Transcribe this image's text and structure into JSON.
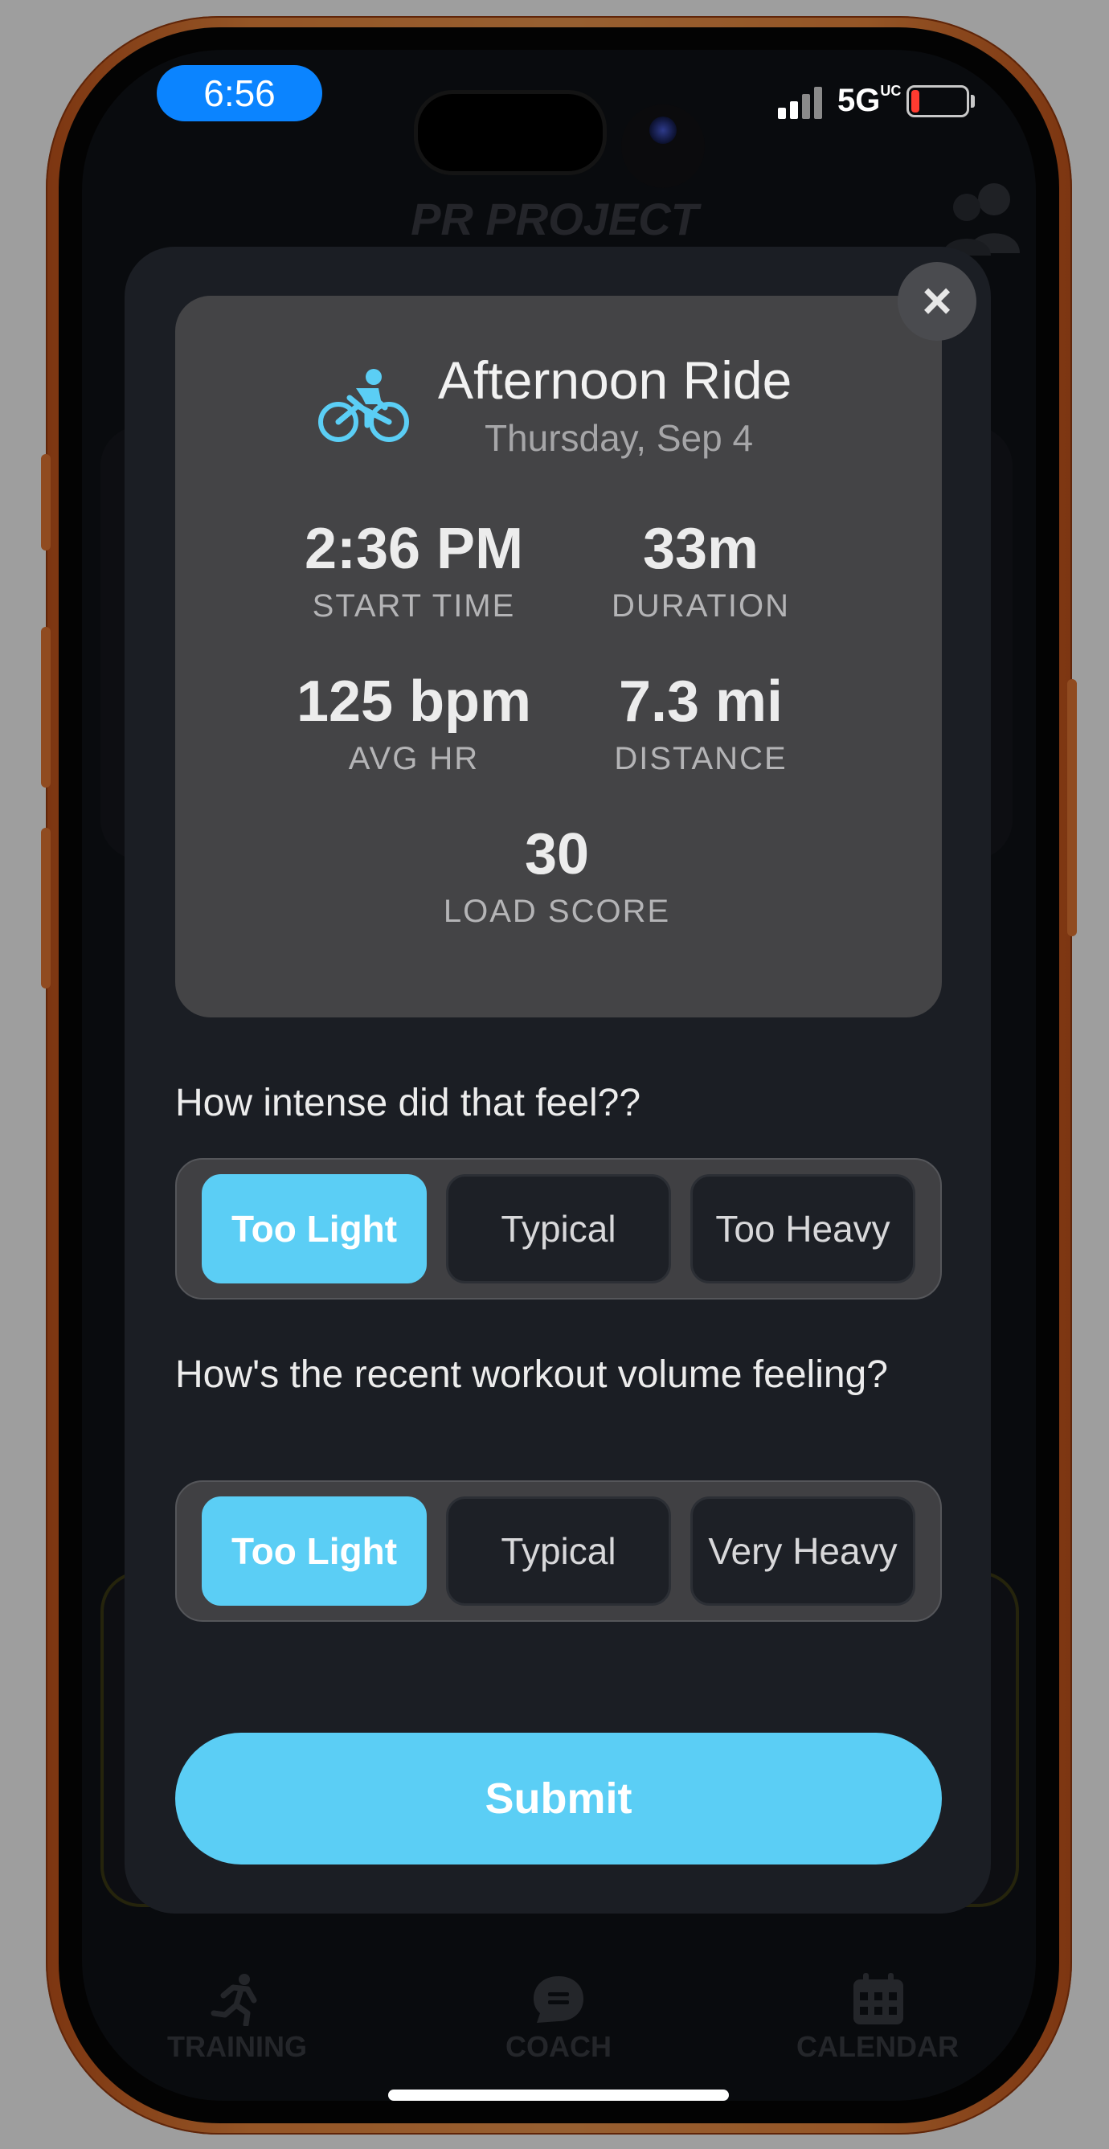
{
  "status_bar": {
    "time": "6:56",
    "network": "5G"
  },
  "background": {
    "app_title": "PR PROJECT",
    "tabs": [
      {
        "label": "TRAINING",
        "icon": "runner-icon"
      },
      {
        "label": "COACH",
        "icon": "chat-bubble-icon"
      },
      {
        "label": "CALENDAR",
        "icon": "calendar-icon"
      }
    ]
  },
  "modal": {
    "close_label": "×",
    "activity": {
      "title": "Afternoon Ride",
      "date": "Thursday, Sep 4",
      "icon": "bike-icon",
      "stats": [
        {
          "value": "2:36 PM",
          "label": "START TIME"
        },
        {
          "value": "33m",
          "label": "DURATION"
        },
        {
          "value": "125 bpm",
          "label": "AVG HR"
        },
        {
          "value": "7.3 mi",
          "label": "DISTANCE"
        },
        {
          "value": "30",
          "label": "LOAD SCORE"
        }
      ]
    },
    "questions": [
      {
        "text": "How intense did that feel??",
        "options": [
          "Too Light",
          "Typical",
          "Too Heavy"
        ],
        "selected": "Too Light"
      },
      {
        "text": "How's the recent workout volume feeling?",
        "options": [
          "Too Light",
          "Typical",
          "Very Heavy"
        ],
        "selected": "Too Light"
      }
    ],
    "submit_label": "Submit"
  },
  "colors": {
    "accent": "#5bcef5",
    "frame": "#f08a3e",
    "modal_bg": "#1b1e24",
    "card_bg": "#444446"
  }
}
